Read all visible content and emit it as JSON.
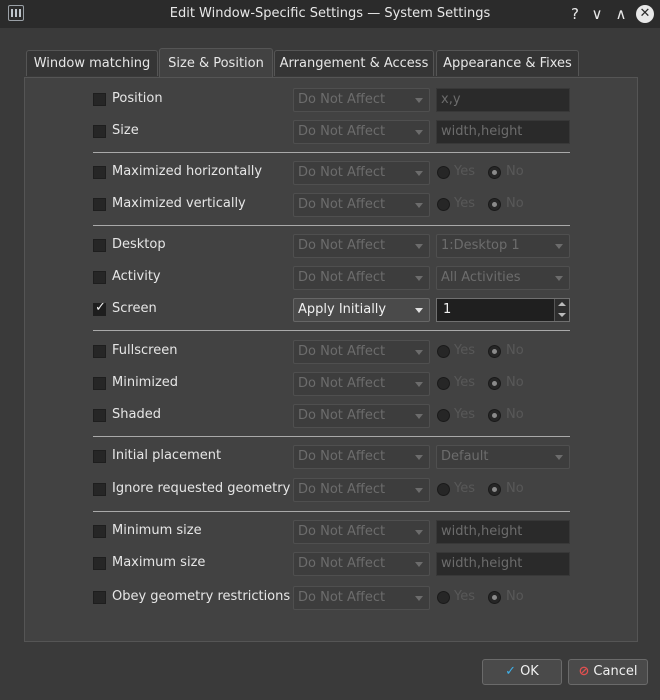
{
  "window": {
    "title": "Edit Window-Specific Settings — System Settings",
    "help": "?",
    "minimize": "∨",
    "maximize": "∧",
    "close": "✕"
  },
  "tabs": [
    {
      "label": "Window matching"
    },
    {
      "label": "Size & Position"
    },
    {
      "label": "Arrangement & Access"
    },
    {
      "label": "Appearance & Fixes"
    }
  ],
  "rows": [
    {
      "label": "Position",
      "checked": false,
      "policy": "Do Not Affect",
      "field_placeholder": "x,y"
    },
    {
      "label": "Size",
      "checked": false,
      "policy": "Do Not Affect",
      "field_placeholder": "width,height"
    },
    {
      "label": "Maximized horizontally",
      "checked": false,
      "policy": "Do Not Affect",
      "yes": "Yes",
      "no": "No",
      "selected": "No"
    },
    {
      "label": "Maximized vertically",
      "checked": false,
      "policy": "Do Not Affect",
      "yes": "Yes",
      "no": "No",
      "selected": "No"
    },
    {
      "label": "Desktop",
      "checked": false,
      "policy": "Do Not Affect",
      "value": "1:Desktop 1"
    },
    {
      "label": "Activity",
      "checked": false,
      "policy": "Do Not Affect",
      "value": "All Activities"
    },
    {
      "label": "Screen",
      "checked": true,
      "policy": "Apply Initially",
      "value": "1"
    },
    {
      "label": "Fullscreen",
      "checked": false,
      "policy": "Do Not Affect",
      "yes": "Yes",
      "no": "No",
      "selected": "No"
    },
    {
      "label": "Minimized",
      "checked": false,
      "policy": "Do Not Affect",
      "yes": "Yes",
      "no": "No",
      "selected": "No"
    },
    {
      "label": "Shaded",
      "checked": false,
      "policy": "Do Not Affect",
      "yes": "Yes",
      "no": "No",
      "selected": "No"
    },
    {
      "label": "Initial placement",
      "checked": false,
      "policy": "Do Not Affect",
      "value": "Default"
    },
    {
      "label": "Ignore requested geometry",
      "checked": false,
      "policy": "Do Not Affect",
      "yes": "Yes",
      "no": "No",
      "selected": "No"
    },
    {
      "label": "Minimum size",
      "checked": false,
      "policy": "Do Not Affect",
      "field_placeholder": "width,height"
    },
    {
      "label": "Maximum size",
      "checked": false,
      "policy": "Do Not Affect",
      "field_placeholder": "width,height"
    },
    {
      "label": "Obey geometry restrictions",
      "checked": false,
      "policy": "Do Not Affect",
      "yes": "Yes",
      "no": "No",
      "selected": "No"
    }
  ],
  "buttons": {
    "ok": "OK",
    "cancel": "Cancel"
  },
  "colors": {
    "background": "#3a3a3a",
    "panel": "#424242",
    "titlebar": "#2b2b2b",
    "ok_icon": "#3fb0e8",
    "cancel_icon": "#e05050"
  }
}
